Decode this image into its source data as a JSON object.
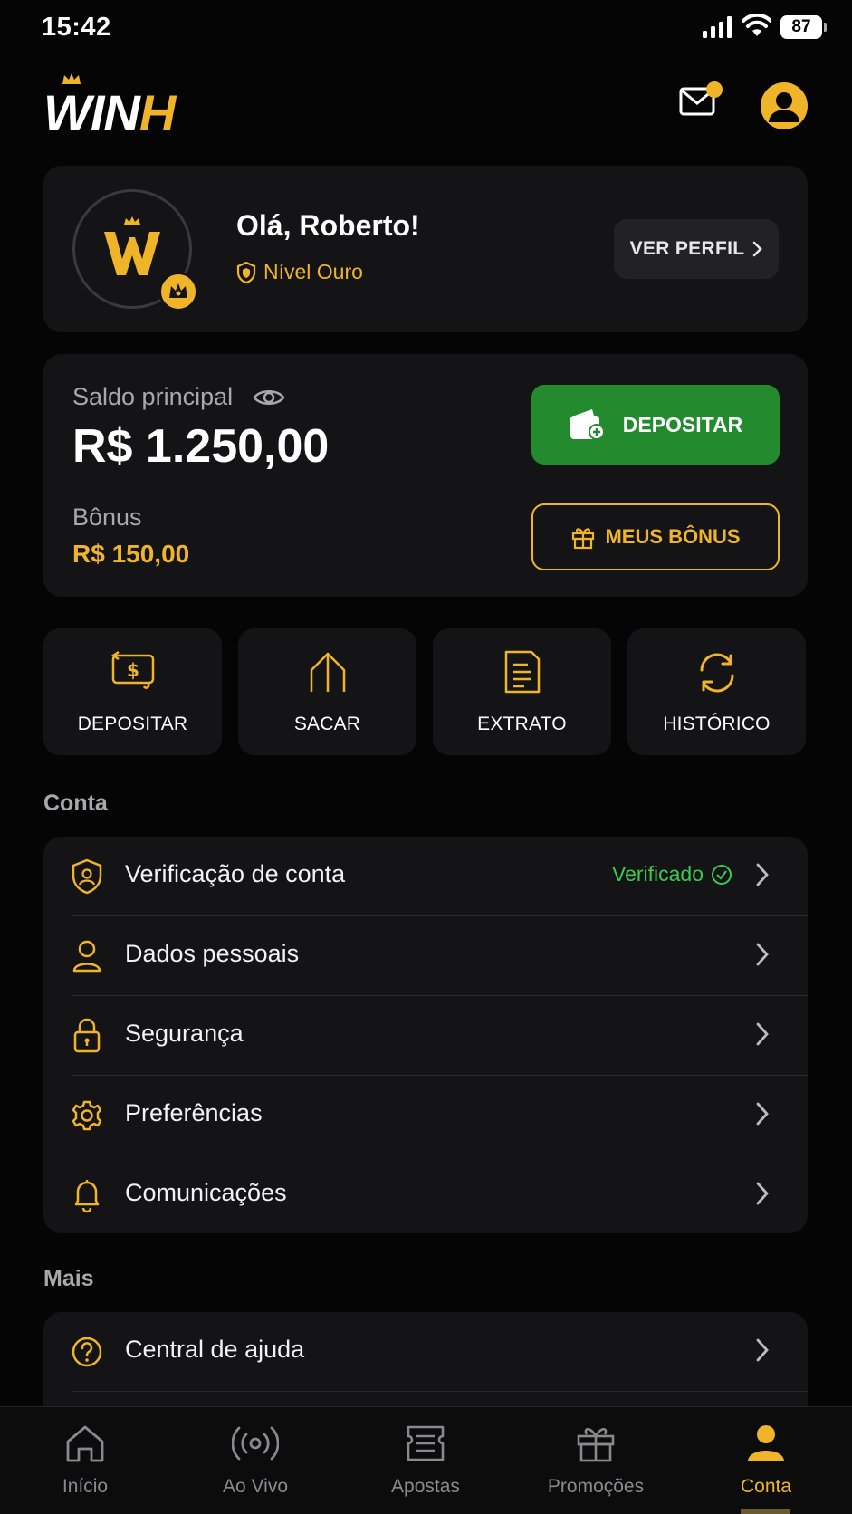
{
  "status_bar": {
    "time": "15:42",
    "battery": "87"
  },
  "header": {
    "logo_text_white": "WIN",
    "logo_text_gold": "H"
  },
  "profile": {
    "greeting": "Olá, Roberto!",
    "level": "Nível Ouro",
    "view_profile": "VER PERFIL"
  },
  "balance": {
    "main_label": "Saldo principal",
    "main_value": "R$ 1.250,00",
    "bonus_label": "Bônus",
    "bonus_value": "R$ 150,00",
    "deposit_button": "DEPOSITAR",
    "bonus_button": "MEUS BÔNUS"
  },
  "quick_actions": [
    {
      "label": "DEPOSITAR",
      "icon": "deposit-money-icon"
    },
    {
      "label": "SACAR",
      "icon": "withdraw-arrow-icon"
    },
    {
      "label": "EXTRATO",
      "icon": "statement-document-icon"
    },
    {
      "label": "HISTÓRICO",
      "icon": "history-refresh-icon"
    }
  ],
  "account_section": {
    "title": "Conta",
    "items": [
      {
        "label": "Verificação de conta",
        "status": "Verificado",
        "icon": "shield-user-icon"
      },
      {
        "label": "Dados pessoais",
        "icon": "person-icon"
      },
      {
        "label": "Segurança",
        "icon": "lock-icon"
      },
      {
        "label": "Preferências",
        "icon": "gear-icon"
      },
      {
        "label": "Comunicações",
        "icon": "bell-icon"
      }
    ]
  },
  "more_section": {
    "title": "Mais",
    "items": [
      {
        "label": "Central de ajuda",
        "icon": "help-circle-icon"
      }
    ]
  },
  "bottom_nav": [
    {
      "label": "Início",
      "icon": "home-icon"
    },
    {
      "label": "Ao Vivo",
      "icon": "live-broadcast-icon"
    },
    {
      "label": "Apostas",
      "icon": "bets-ticket-icon"
    },
    {
      "label": "Promoções",
      "icon": "gift-icon"
    },
    {
      "label": "Conta",
      "icon": "account-icon",
      "active": true
    }
  ],
  "colors": {
    "accent": "#f0b429",
    "success": "#3dc94f",
    "deposit": "#238b2e",
    "background": "#050505",
    "card": "#141416"
  }
}
